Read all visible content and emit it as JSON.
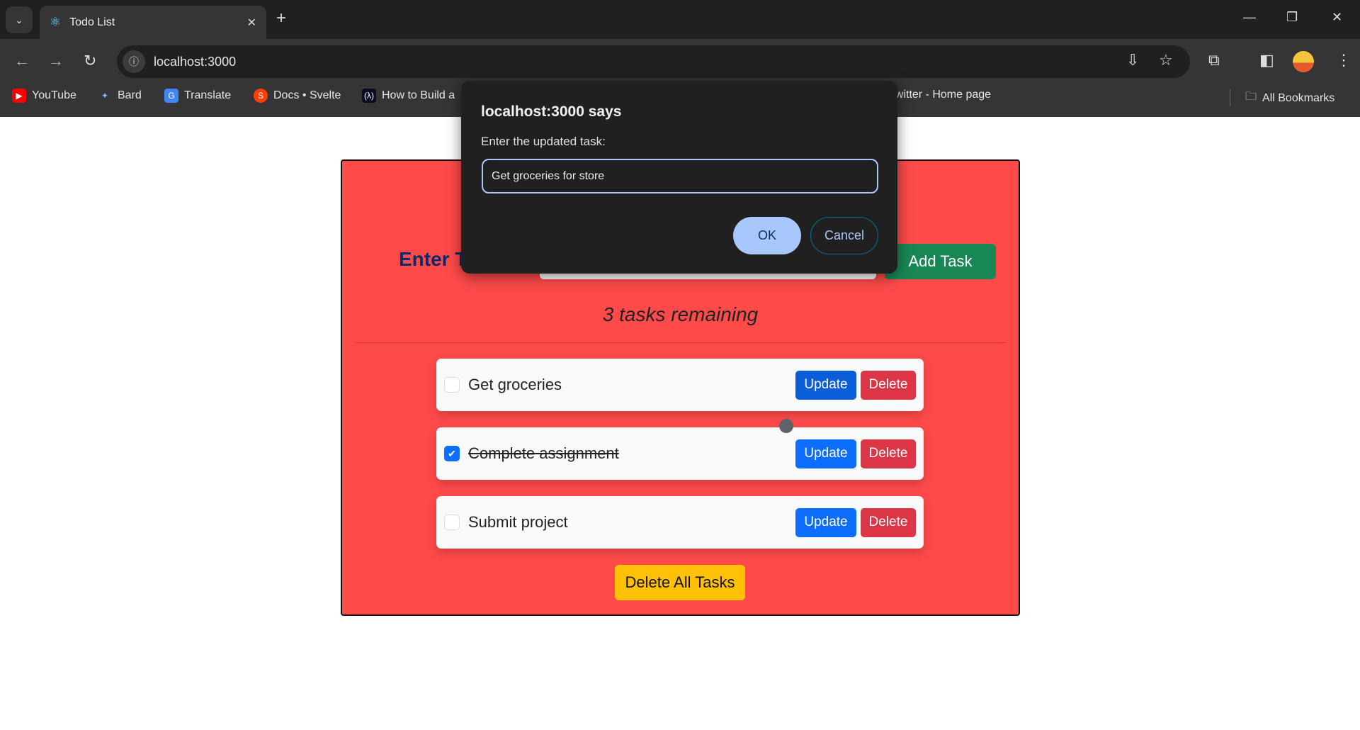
{
  "browser": {
    "tab_title": "Todo List",
    "url": "localhost:3000",
    "bookmarks": [
      {
        "label": "YouTube",
        "icon": "youtube-icon"
      },
      {
        "label": "Bard",
        "icon": "bard-icon"
      },
      {
        "label": "Translate",
        "icon": "translate-icon"
      },
      {
        "label": "Docs • Svelte",
        "icon": "svelte-icon"
      },
      {
        "label": "How to Build a",
        "icon": "freecodecamp-icon"
      },
      {
        "label": "Twitter - Home page",
        "icon": "twitter-icon"
      }
    ],
    "all_bookmarks": "All Bookmarks"
  },
  "app": {
    "heading": "Enter Task",
    "add_button": "Add Task",
    "remaining": "3 tasks remaining",
    "tasks": [
      {
        "text": "Get groceries",
        "done": false
      },
      {
        "text": "Complete assignment",
        "done": true
      },
      {
        "text": "Submit project",
        "done": false
      }
    ],
    "update_label": "Update",
    "delete_label": "Delete",
    "delete_all": "Delete All Tasks",
    "colors": {
      "card": "#ff4a4a",
      "update": "#0d6efd",
      "delete": "#dc3545",
      "add": "#198754",
      "delete_all": "#ffc107"
    }
  },
  "dialog": {
    "title": "localhost:3000 says",
    "message": "Enter the updated task:",
    "value": "Get groceries for store",
    "ok": "OK",
    "cancel": "Cancel"
  }
}
